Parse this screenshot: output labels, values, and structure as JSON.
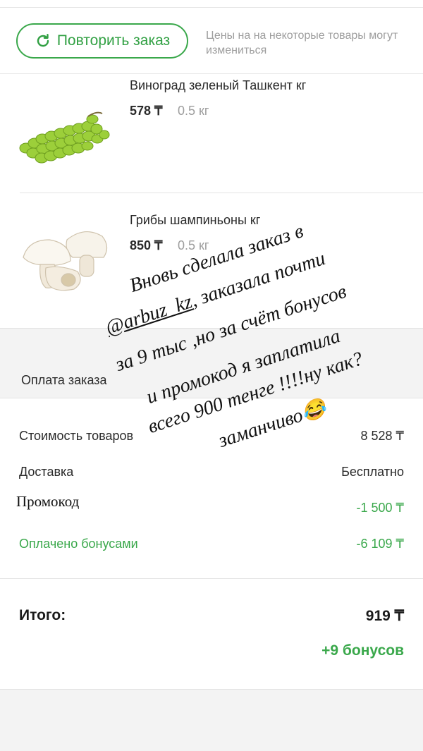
{
  "header": {
    "repeat_button": "Повторить заказ",
    "price_note": "Цены на на некоторые товары могут измениться"
  },
  "products": [
    {
      "name": "Виноград зеленый Ташкент кг",
      "price": "578 ₸",
      "weight": "0.5 кг",
      "image": "green-grapes"
    },
    {
      "name": "Грибы шампиньоны кг",
      "price": "850 ₸",
      "weight": "0.5 кг",
      "image": "champignon-mushrooms"
    }
  ],
  "payment": {
    "title": "Оплата заказа",
    "rows": [
      {
        "label": "Стоимость товаров",
        "value": "8 528 ₸"
      },
      {
        "label": "Доставка",
        "value": "Бесплатно"
      },
      {
        "label": "Промокод",
        "value": "-1 500 ₸"
      },
      {
        "label": "Оплачено бонусами",
        "value": "-6 109 ₸"
      }
    ],
    "total_label": "Итого:",
    "total_value": "919 ₸",
    "bonus_earned": "+9 бонусов"
  },
  "overlay_text": {
    "line1": "Вновь сделала заказ в",
    "line2a": "@arbuz_kz",
    "line2b": ", заказала почти",
    "line3": "за 9 тыс ,но за счёт бонусов",
    "line4": "и промокод я заплатила",
    "line5": "всего 900 тенге !!!!ну как?",
    "line6": "заманчиво😂"
  },
  "colors": {
    "accent_green": "#3aa84b",
    "muted_gray": "#9d9d9d",
    "band_gray": "#f3f3f3"
  }
}
